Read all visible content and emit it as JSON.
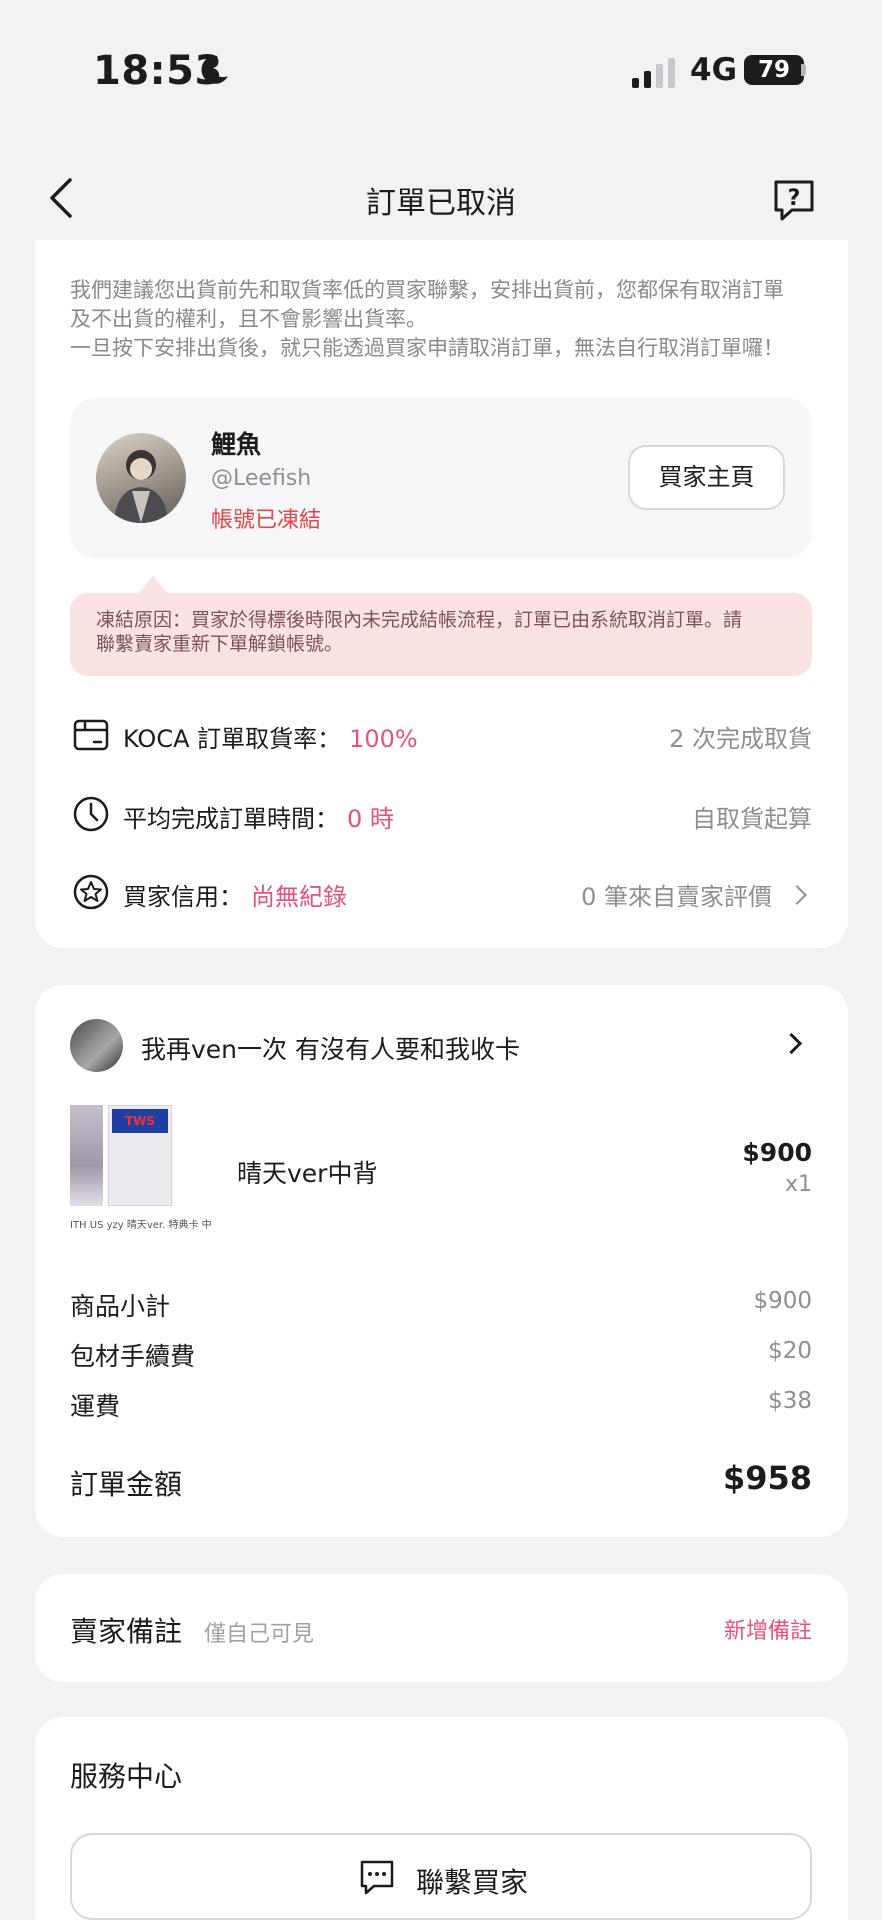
{
  "status_bar": {
    "time": "18:53",
    "network": "4G",
    "battery": "79"
  },
  "nav": {
    "title": "訂單已取消"
  },
  "notice": {
    "line1": "我們建議您出貨前先和取貨率低的買家聯繫，安排出貨前，您都保有取消訂單",
    "line2": "及不出貨的權利，且不會影響出貨率。",
    "line3": "一旦按下安排出貨後，就只能透過買家申請取消訂單，無法自行取消訂單囉！"
  },
  "buyer": {
    "name": "鯉魚",
    "handle": "@Leefish",
    "status": "帳號已凍結",
    "profile_button": "買家主頁"
  },
  "freeze": {
    "line1": "凍結原因：買家於得標後時限內未完成結帳流程，訂單已由系統取消訂單。請",
    "line2": "聯繫賣家重新下單解鎖帳號。"
  },
  "stats": {
    "pickup": {
      "label": "KOCA 訂單取貨率：",
      "value": "100%",
      "right": "2 次完成取貨"
    },
    "time": {
      "label": "平均完成訂單時間：",
      "value": "0 時",
      "right": "自取貨起算"
    },
    "credit": {
      "label": "買家信用：",
      "value": "尚無紀錄",
      "right": "0 筆來自賣家評價"
    }
  },
  "product_section": {
    "seller_name": "我再ven一次 有沒有人要和我收卡",
    "thumb_caption": "ITH US yzy 晴天ver. 特典卡 中文",
    "thumb_logo": "TWS",
    "product_name": "晴天ver中背",
    "price": "$900",
    "qty": "x1"
  },
  "summary": {
    "subtotal_label": "商品小計",
    "subtotal_value": "$900",
    "packaging_label": "包材手續費",
    "packaging_value": "$20",
    "shipping_label": "運費",
    "shipping_value": "$38",
    "total_label": "訂單金額",
    "total_value": "$958"
  },
  "seller_note": {
    "title": "賣家備註",
    "subtitle": "僅自己可見",
    "add": "新增備註"
  },
  "service": {
    "title": "服務中心",
    "contact_button": "聯繫買家"
  },
  "colors": {
    "accent": "#e8517b",
    "danger": "#e0474c",
    "freeze_bg": "#fbe2e2"
  }
}
